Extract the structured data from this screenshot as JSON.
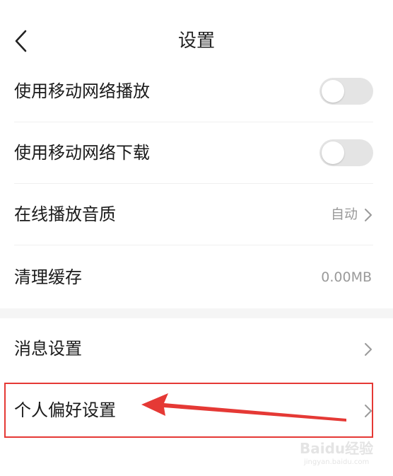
{
  "header": {
    "title": "设置",
    "back_icon": "chevron-left-icon"
  },
  "settings": {
    "mobile_play": {
      "label": "使用移动网络播放",
      "enabled": false
    },
    "mobile_download": {
      "label": "使用移动网络下载",
      "enabled": false
    },
    "quality": {
      "label": "在线播放音质",
      "value": "自动"
    },
    "clear_cache": {
      "label": "清理缓存",
      "value": "0.00MB"
    },
    "messages": {
      "label": "消息设置"
    },
    "preferences": {
      "label": "个人偏好设置"
    }
  },
  "annotation": {
    "box_color": "#e53935",
    "arrow_color": "#e53935"
  },
  "watermark": {
    "text": "Baidu经验",
    "url_text": "jingyan.baidu.com"
  },
  "colors": {
    "toggle_off": "#e4e4e4",
    "secondary_text": "#9a9a9a",
    "section_gap": "#f5f5f5"
  }
}
